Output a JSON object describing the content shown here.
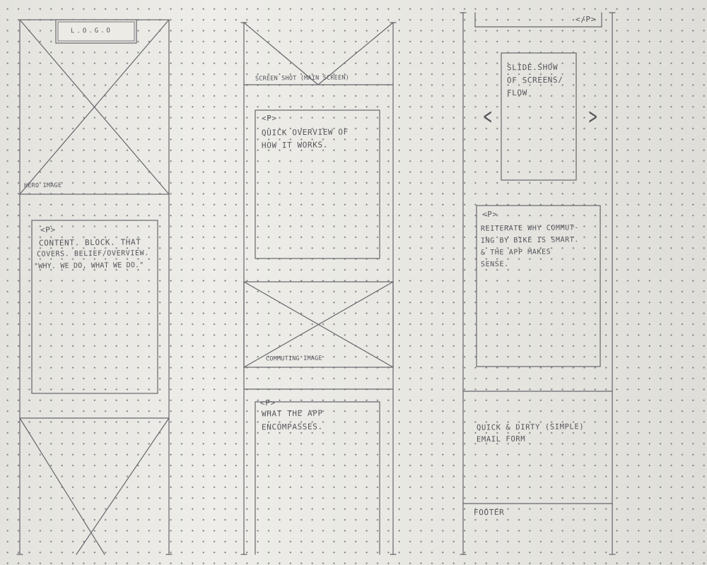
{
  "column1": {
    "logo": "L.O.G.O",
    "hero_label": "HERO IMAGE",
    "content_block": {
      "tag": "<P>",
      "lines": [
        "CONTENT. BLOCK. THAT",
        "COVERS. BELIEF/OVERVIEW.",
        "\"WHY. WE DO, WHAT WE DO.\""
      ]
    }
  },
  "column2": {
    "screenshot_label": "SCREEN SHOT (MAIN SCREEN)",
    "overview_block": {
      "tag": "<P>",
      "lines": [
        "QUICK OVERVIEW OF",
        "HOW IT WORKS."
      ]
    },
    "commuting_label": "COMMUTING IMAGE",
    "encompass_block": {
      "tag": "<P>",
      "lines": [
        "WHAT THE APP",
        "ENCOMPASSES."
      ]
    }
  },
  "column3": {
    "top_tag": "</P>",
    "slideshow": {
      "lines": [
        "SLIDE.SHOW",
        "OF SCREENS/",
        "FLOW"
      ],
      "prev_arrow": "<",
      "next_arrow": ">"
    },
    "reiterate_block": {
      "tag": "<P>",
      "lines": [
        "REITERATE WHY COMMUT-",
        "ING BY BIKE IS SMART.",
        "& THE APP MAKES",
        "SENSE."
      ]
    },
    "email_block": {
      "lines": [
        "QUICK & DIRTY (SIMPLE)",
        "EMAIL FORM"
      ]
    },
    "footer": "FOOTER"
  }
}
